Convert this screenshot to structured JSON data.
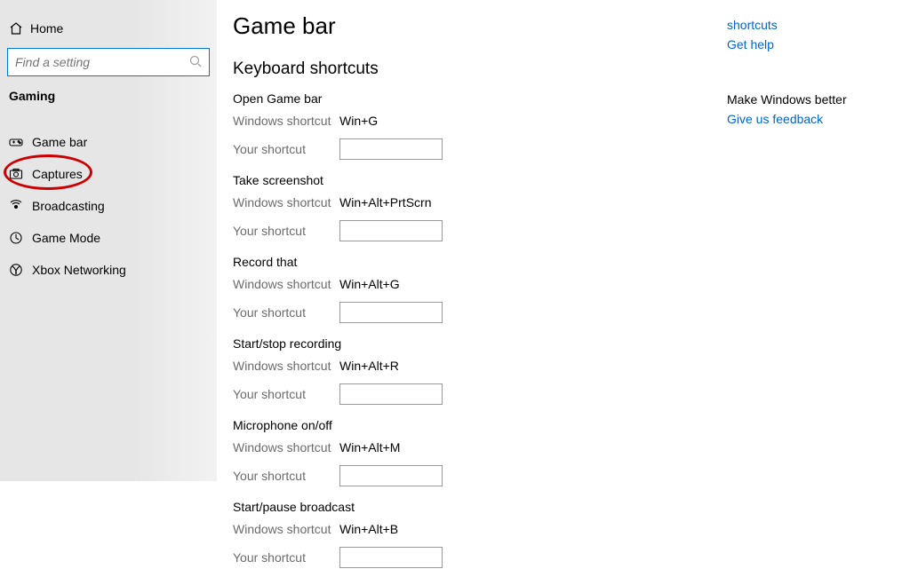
{
  "sidebar": {
    "home": "Home",
    "search_placeholder": "Find a setting",
    "category": "Gaming",
    "items": [
      {
        "label": "Game bar"
      },
      {
        "label": "Captures"
      },
      {
        "label": "Broadcasting"
      },
      {
        "label": "Game Mode"
      },
      {
        "label": "Xbox Networking"
      }
    ]
  },
  "page": {
    "title": "Game bar",
    "section": "Keyboard shortcuts",
    "ws_label": "Windows shortcut",
    "ys_label": "Your shortcut",
    "groups": [
      {
        "title": "Open Game bar",
        "ws": "Win+G"
      },
      {
        "title": "Take screenshot",
        "ws": "Win+Alt+PrtScrn"
      },
      {
        "title": "Record that",
        "ws": "Win+Alt+G"
      },
      {
        "title": "Start/stop recording",
        "ws": "Win+Alt+R"
      },
      {
        "title": "Microphone on/off",
        "ws": "Win+Alt+M"
      },
      {
        "title": "Start/pause broadcast",
        "ws": "Win+Alt+B"
      }
    ]
  },
  "right": {
    "links": [
      "shortcuts",
      "Get help"
    ],
    "header": "Make Windows better",
    "feedback": "Give us feedback"
  }
}
